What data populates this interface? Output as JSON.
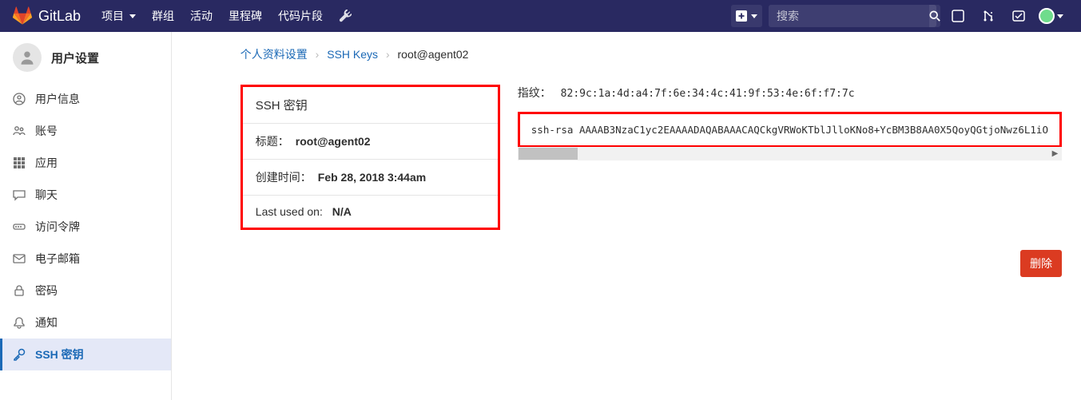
{
  "brand": "GitLab",
  "nav": {
    "projects": "项目",
    "groups": "群组",
    "activity": "活动",
    "milestones": "里程碑",
    "snippets": "代码片段"
  },
  "search": {
    "placeholder": "搜索"
  },
  "sidebar": {
    "title": "用户设置",
    "items": {
      "profile": "用户信息",
      "account": "账号",
      "apps": "应用",
      "chat": "聊天",
      "tokens": "访问令牌",
      "emails": "电子邮箱",
      "password": "密码",
      "notifications": "通知",
      "ssh": "SSH 密钥"
    }
  },
  "breadcrumb": {
    "a": "个人资料设置",
    "b": "SSH Keys",
    "c": "root@agent02"
  },
  "card": {
    "title": "SSH 密钥",
    "label_title": "标题：",
    "val_title": "root@agent02",
    "label_created": "创建时间：",
    "val_created": "Feb 28, 2018 3:44am",
    "label_last": "Last used on: ",
    "val_last": "N/A"
  },
  "fingerprint": {
    "label": "指纹：",
    "value": "82:9c:1a:4d:a4:7f:6e:34:4c:41:9f:53:4e:6f:f7:7c"
  },
  "ssh_key": "ssh-rsa AAAAB3NzaC1yc2EAAAADAQABAAACAQCkgVRWoKTblJlloKNo8+YcBM3B8AA0X5QoyQGtjoNwz6L1iO",
  "delete": "删除"
}
